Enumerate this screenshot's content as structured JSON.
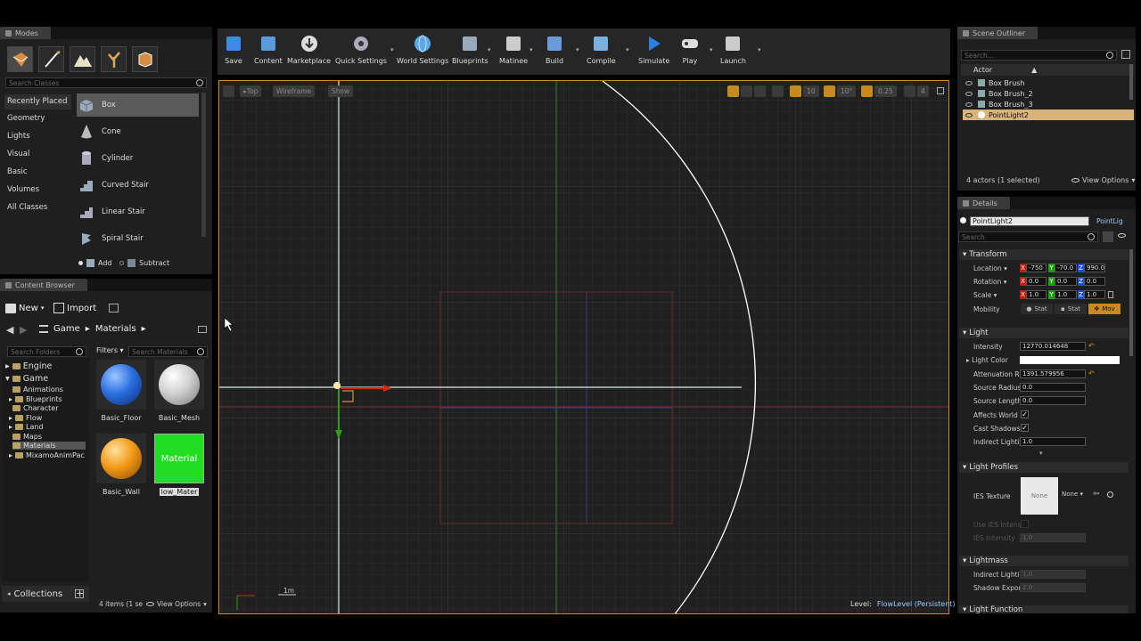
{
  "modes": {
    "tab": "Modes",
    "search_placeholder": "Search Classes",
    "categories": [
      "Recently Placed",
      "Geometry",
      "Lights",
      "Visual",
      "Basic",
      "Volumes",
      "All Classes"
    ],
    "items": [
      "Box",
      "Cone",
      "Cylinder",
      "Curved Stair",
      "Linear Stair",
      "Spiral Stair"
    ],
    "add_label": "Add",
    "subtract_label": "Subtract"
  },
  "toolbar": {
    "items": [
      "Save",
      "Content",
      "Marketplace",
      "Quick Settings",
      "World Settings",
      "Blueprints",
      "Matinee",
      "Build",
      "Compile",
      "Simulate",
      "Play",
      "Launch"
    ]
  },
  "viewport": {
    "view_label": "Top",
    "mode_label": "Wireframe",
    "show_label": "Show",
    "grid_snap": "10",
    "rot_snap": "10°",
    "scale_snap": "0.25",
    "cam_speed": "4",
    "scale_label": "1m",
    "level_label": "Level:",
    "level_name": "FlowLevel (Persistent)"
  },
  "content_browser": {
    "tab": "Content Browser",
    "new_label": "New",
    "import_label": "Import",
    "path": [
      "Game",
      "Materials"
    ],
    "folder_search": "Search Folders",
    "filters_label": "Filters",
    "search_materials": "Search Materials",
    "tree": [
      "Engine",
      "Game",
      "Animations",
      "Blueprints",
      "Character",
      "Flow",
      "Land",
      "Maps",
      "Materials",
      "MixamoAnimPac"
    ],
    "assets": [
      {
        "name": "Basic_Floor",
        "color": "#2a6fe0"
      },
      {
        "name": "Basic_Mesh",
        "color": "#cfcfcf"
      },
      {
        "name": "Basic_Wall",
        "color": "#f29a18"
      },
      {
        "name": "low_Mater",
        "color": "#22dd22",
        "thumb_label": "Material"
      }
    ],
    "collections_label": "Collections",
    "status": "4 items (1 se",
    "view_options": "View Options"
  },
  "outliner": {
    "tab": "Scene Outliner",
    "search_placeholder": "Search...",
    "column": "Actor",
    "rows": [
      "Box Brush",
      "Box Brush_2",
      "Box Brush_3",
      "PointLight2"
    ],
    "status": "4 actors (1 selected)",
    "view_options": "View Options"
  },
  "details": {
    "tab": "Details",
    "name": "PointLight2",
    "class_label": "PointLig",
    "search_placeholder": "Search",
    "transform": {
      "title": "Transform",
      "location_label": "Location",
      "location": [
        "-750",
        "-70.0",
        "990.0"
      ],
      "rotation_label": "Rotation",
      "rotation": [
        "0.0",
        "0.0",
        "0.0"
      ],
      "scale_label": "Scale",
      "scale": [
        "1.0",
        "1.0",
        "1.0"
      ],
      "mobility_label": "Mobility",
      "mobility": [
        "Stat",
        "Stat",
        "Mov"
      ]
    },
    "light": {
      "title": "Light",
      "intensity_label": "Intensity",
      "intensity": "12770.014648",
      "light_color_label": "Light Color",
      "attenuation_label": "Attenuation R",
      "attenuation": "1391.579956",
      "source_radius_label": "Source Radius",
      "source_radius": "0.0",
      "source_length_label": "Source Length",
      "source_length": "0.0",
      "affects_world_label": "Affects World",
      "cast_shadows_label": "Cast Shadows",
      "indirect_label": "Indirect Lighti",
      "indirect": "1.0"
    },
    "light_profiles": {
      "title": "Light Profiles",
      "ies_label": "IES Texture",
      "ies_value": "None",
      "ies_dropdown": "None",
      "use_ies_label": "Use IES Intens",
      "ies_intensity_label": "IES Intensity",
      "ies_intensity": "1.0"
    },
    "lightmass": {
      "title": "Lightmass",
      "indirect_label": "Indirect Lighti",
      "indirect": "1.0",
      "shadow_label": "Shadow Expon",
      "shadow": "2.0"
    },
    "light_function": "Light Function"
  }
}
